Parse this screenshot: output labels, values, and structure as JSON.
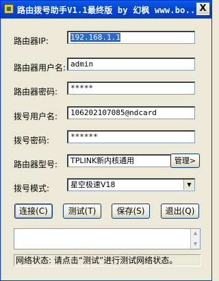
{
  "window": {
    "title": "路由拨号助手V1.1最终版 by 幻枫 www.bo...",
    "close_label": "X"
  },
  "form": {
    "router_ip": {
      "label": "路由器IP:",
      "value": "192.168.1.1"
    },
    "router_user": {
      "label": "路由器用户名:",
      "value": "admin"
    },
    "router_pass": {
      "label": "路由器密码:",
      "value": "*****"
    },
    "dial_user": {
      "label": "拨号用户名:",
      "value": "106202107085@ndcard"
    },
    "dial_pass": {
      "label": "拨号密码:",
      "value": "******"
    },
    "router_model": {
      "label": "路由器型号:",
      "value": "TPLINK新内核通用",
      "manage_label": "管理>"
    },
    "dial_mode": {
      "label": "拨号模式:",
      "value": "星空极速V18"
    }
  },
  "buttons": {
    "connect": "连接(C)",
    "test": "测试(T)",
    "save": "保存(S)",
    "exit": "退出(Q)"
  },
  "status": {
    "text": "网络状态: 请点击“测试”进行测试网络状态。"
  }
}
